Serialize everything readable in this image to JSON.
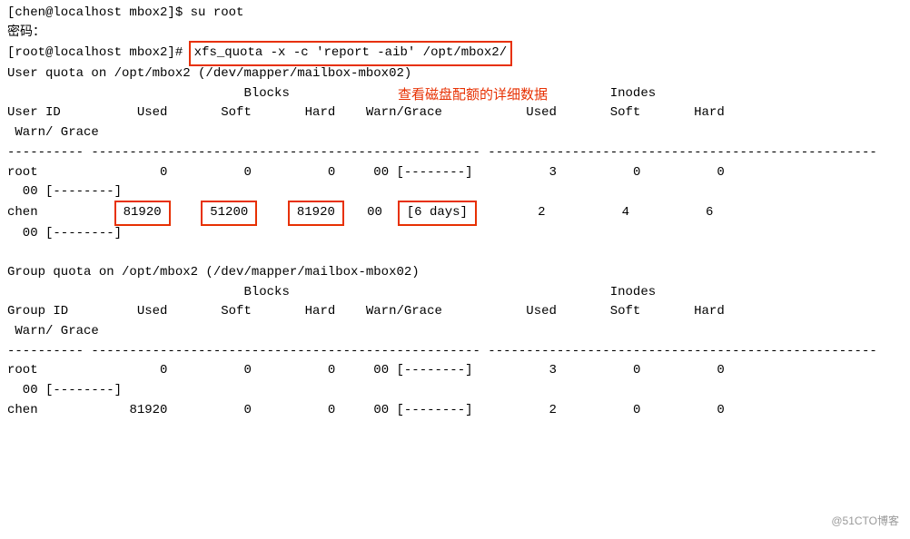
{
  "prompts": {
    "p1_user": "[chen@localhost mbox2]$ ",
    "p1_cmd": "su root",
    "p2": "密码：",
    "p3_user": "[root@localhost mbox2]# ",
    "p3_cmd": "xfs_quota -x -c 'report -aib' /opt/mbox2/"
  },
  "annotation": "查看磁盘配额的详细数据",
  "user_quota": {
    "title": "User quota on /opt/mbox2 (/dev/mapper/mailbox-mbox02)",
    "blocks_header": "                               Blocks                                          Inodes",
    "columns": "User ID          Used       Soft       Hard    Warn/Grace           Used       Soft       Hard",
    "warn_grace": " Warn/ Grace",
    "sep": "---------- --------------------------------------------------- ---------------------------------------------------",
    "rows": {
      "root": {
        "name": "root",
        "b_used": "0",
        "b_soft": "0",
        "b_hard": "0",
        "b_warn": "00 [--------]",
        "i_used": "3",
        "i_soft": "0",
        "i_hard": "0",
        "i_warn": "  00 [--------]"
      },
      "chen": {
        "name": "chen",
        "b_used": "81920",
        "b_soft": "51200",
        "b_hard": "81920",
        "b_warn_prefix": "00",
        "b_warn_grace": "[6 days]",
        "i_used": "2",
        "i_soft": "4",
        "i_hard": "6",
        "i_warn": "  00 [--------]"
      }
    }
  },
  "group_quota": {
    "title": "Group quota on /opt/mbox2 (/dev/mapper/mailbox-mbox02)",
    "blocks_header": "                               Blocks                                          Inodes",
    "columns": "Group ID         Used       Soft       Hard    Warn/Grace           Used       Soft       Hard",
    "warn_grace": " Warn/ Grace",
    "sep": "---------- --------------------------------------------------- ---------------------------------------------------",
    "rows": {
      "root": {
        "name": "root",
        "b_used": "0",
        "b_soft": "0",
        "b_hard": "0",
        "b_warn": "00 [--------]",
        "i_used": "3",
        "i_soft": "0",
        "i_hard": "0",
        "i_warn": "  00 [--------]"
      },
      "chen": {
        "name": "chen",
        "b_used": "81920",
        "b_soft": "0",
        "b_hard": "0",
        "b_warn": "00 [--------]",
        "i_used": "2",
        "i_soft": "0",
        "i_hard": "0",
        "i_warn": ""
      }
    }
  },
  "watermark": "@51CTO博客"
}
